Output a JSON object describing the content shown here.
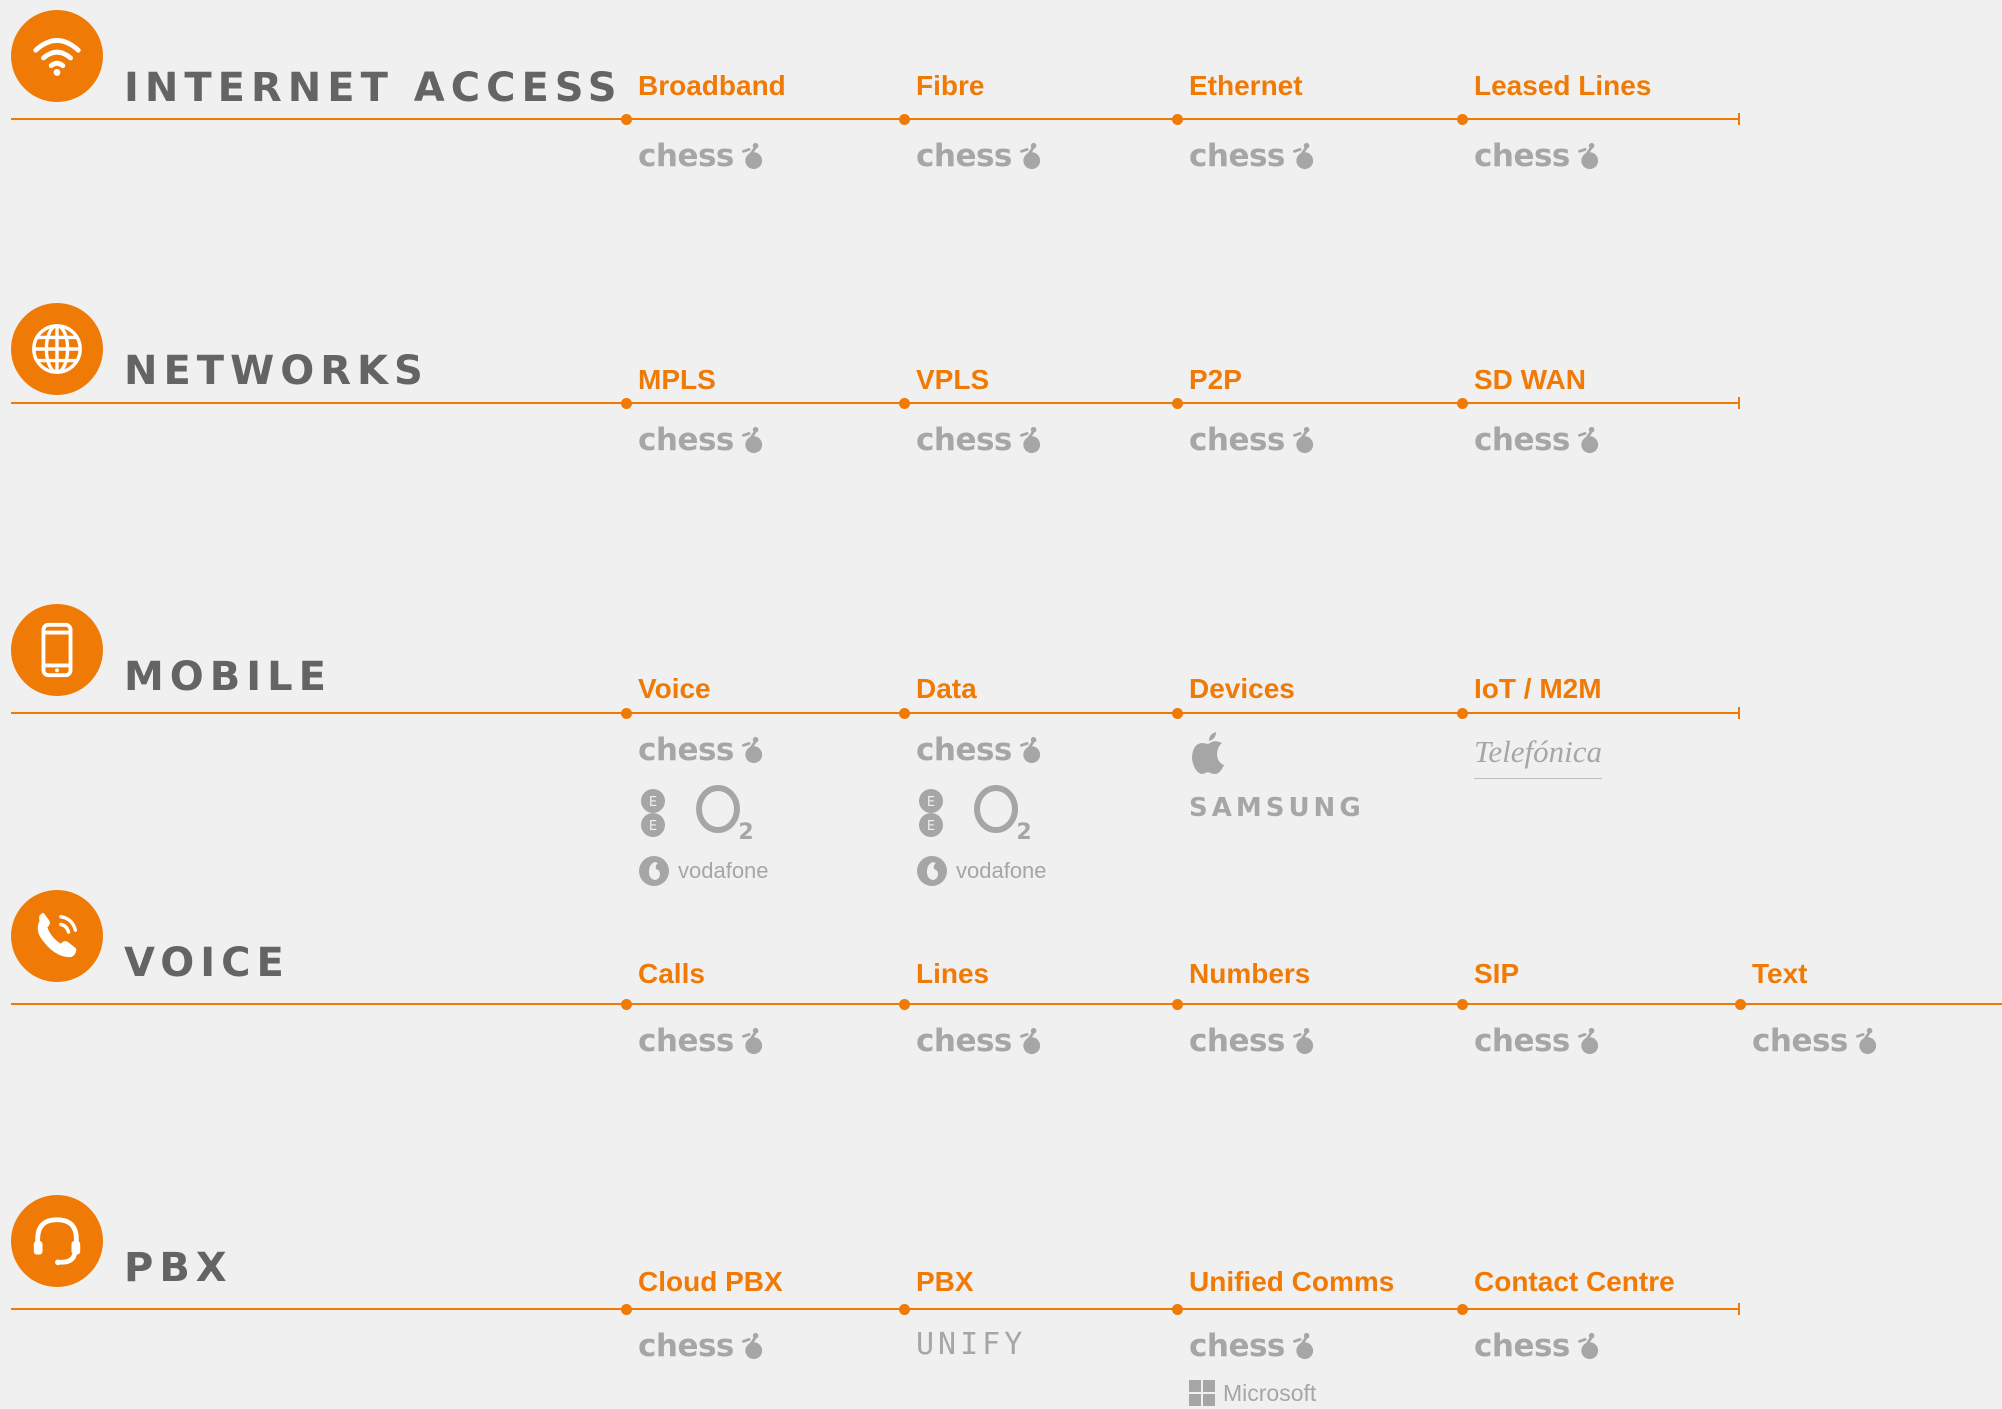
{
  "colors": {
    "accent": "#ef7a06",
    "heading": "#646464",
    "logo": "#a6a6a6",
    "background": "#f0f0f0"
  },
  "sections": [
    {
      "title": "INTERNET ACCESS",
      "icon": "wifi-icon",
      "columns": [
        {
          "label": "Broadband",
          "logos": [
            {
              "brand": "chess"
            }
          ]
        },
        {
          "label": "Fibre",
          "logos": [
            {
              "brand": "chess"
            }
          ]
        },
        {
          "label": "Ethernet",
          "logos": [
            {
              "brand": "chess"
            }
          ]
        },
        {
          "label": "Leased Lines",
          "logos": [
            {
              "brand": "chess"
            }
          ]
        }
      ]
    },
    {
      "title": "NETWORKS",
      "icon": "globe-icon",
      "columns": [
        {
          "label": "MPLS",
          "logos": [
            {
              "brand": "chess"
            }
          ]
        },
        {
          "label": "VPLS",
          "logos": [
            {
              "brand": "chess"
            }
          ]
        },
        {
          "label": "P2P",
          "logos": [
            {
              "brand": "chess"
            }
          ]
        },
        {
          "label": "SD WAN",
          "logos": [
            {
              "brand": "chess"
            }
          ]
        }
      ]
    },
    {
      "title": "MOBILE",
      "icon": "smartphone-icon",
      "columns": [
        {
          "label": "Voice",
          "logos": [
            {
              "brand": "chess"
            },
            {
              "brand": "ee-o2"
            },
            {
              "brand": "vodafone",
              "text": "vodafone"
            }
          ]
        },
        {
          "label": "Data",
          "logos": [
            {
              "brand": "chess"
            },
            {
              "brand": "ee-o2"
            },
            {
              "brand": "vodafone",
              "text": "vodafone"
            }
          ]
        },
        {
          "label": "Devices",
          "logos": [
            {
              "brand": "apple"
            },
            {
              "brand": "samsung",
              "text": "SAMSUNG"
            }
          ]
        },
        {
          "label": "IoT / M2M",
          "logos": [
            {
              "brand": "telefonica",
              "text": "Telefónica"
            }
          ]
        }
      ]
    },
    {
      "title": "VOICE",
      "icon": "phone-call-icon",
      "columns": [
        {
          "label": "Calls",
          "logos": [
            {
              "brand": "chess"
            }
          ]
        },
        {
          "label": "Lines",
          "logos": [
            {
              "brand": "chess"
            }
          ]
        },
        {
          "label": "Numbers",
          "logos": [
            {
              "brand": "chess"
            }
          ]
        },
        {
          "label": "SIP",
          "logos": [
            {
              "brand": "chess"
            }
          ]
        },
        {
          "label": "Text",
          "logos": [
            {
              "brand": "chess"
            }
          ]
        }
      ]
    },
    {
      "title": "PBX",
      "icon": "headset-icon",
      "columns": [
        {
          "label": "Cloud PBX",
          "logos": [
            {
              "brand": "chess"
            }
          ]
        },
        {
          "label": "PBX",
          "logos": [
            {
              "brand": "unify",
              "text": "UNIFY"
            }
          ]
        },
        {
          "label": "Unified Comms",
          "logos": [
            {
              "brand": "chess"
            },
            {
              "brand": "microsoft",
              "text": "Microsoft"
            }
          ]
        },
        {
          "label": "Contact Centre",
          "logos": [
            {
              "brand": "chess"
            }
          ]
        }
      ]
    }
  ]
}
